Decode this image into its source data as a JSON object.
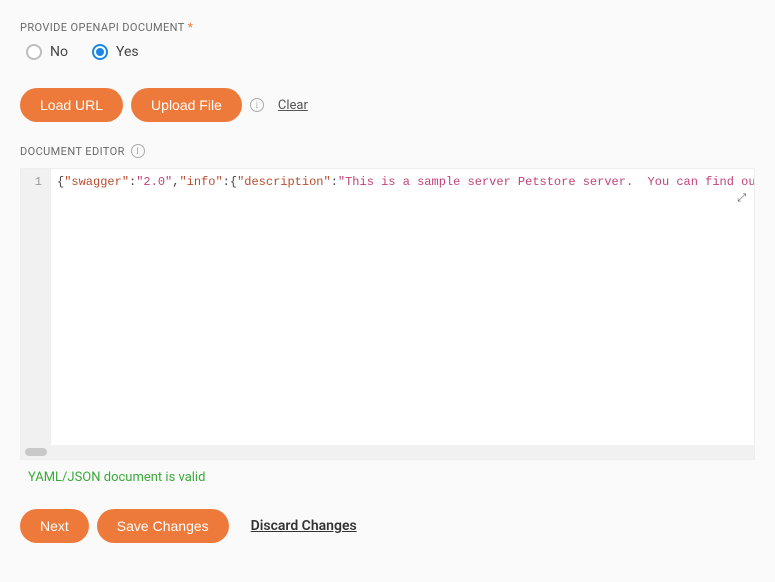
{
  "section1": {
    "label": "PROVIDE OPENAPI DOCUMENT",
    "required_marker": "*",
    "options": {
      "no": "No",
      "yes": "Yes"
    },
    "selected": "yes"
  },
  "actions": {
    "load_url": "Load URL",
    "upload_file": "Upload File",
    "clear": "Clear"
  },
  "editor": {
    "label": "DOCUMENT EDITOR",
    "line_numbers": [
      "1"
    ],
    "tokens": [
      {
        "t": "punc",
        "v": "{"
      },
      {
        "t": "key",
        "v": "\"swagger\""
      },
      {
        "t": "punc",
        "v": ":"
      },
      {
        "t": "str",
        "v": "\"2.0\""
      },
      {
        "t": "punc",
        "v": ","
      },
      {
        "t": "key",
        "v": "\"info\""
      },
      {
        "t": "punc",
        "v": ":{"
      },
      {
        "t": "key",
        "v": "\"description\""
      },
      {
        "t": "punc",
        "v": ":"
      },
      {
        "t": "str",
        "v": "\"This is a sample server Petstore server.  You can find ou"
      }
    ],
    "expand_glyph": "⤢",
    "validation_message": "YAML/JSON document is valid"
  },
  "footer": {
    "next": "Next",
    "save": "Save Changes",
    "discard": "Discard Changes"
  }
}
